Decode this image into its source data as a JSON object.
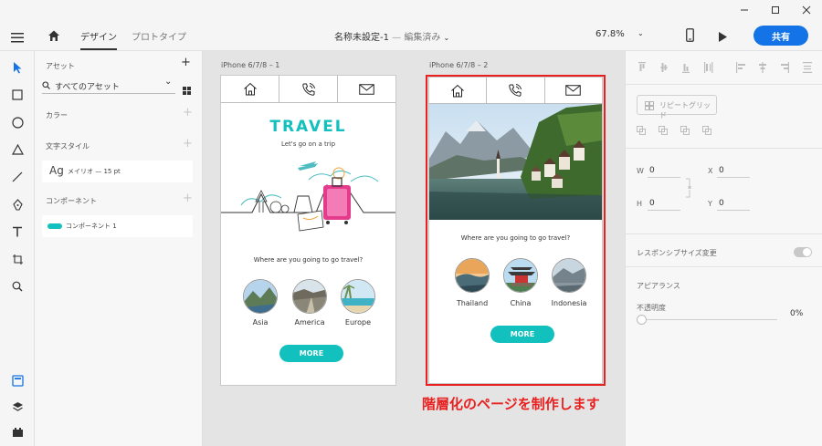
{
  "toolbar": {
    "tab_design": "デザイン",
    "tab_prototype": "プロトタイプ",
    "document_title": "名称未設定-1",
    "separator": "—",
    "save_status": "編集済み",
    "zoom": "67.8%",
    "share_label": "共有"
  },
  "assets": {
    "header": "アセット",
    "filter_value": "すべてのアセット",
    "colors_label": "カラー",
    "char_styles_label": "文字スタイル",
    "char_style_sample": "Ag",
    "char_style_name": "メイリオ — 15 pt",
    "components_label": "コンポーネント",
    "component_name": "コンポーネント 1"
  },
  "artboard1": {
    "title": "iPhone 6/7/8 – 1",
    "heading": "TRAVEL",
    "tagline": "Let's go on a trip",
    "question": "Where are you going to go travel?",
    "destinations": [
      "Asia",
      "America",
      "Europe"
    ],
    "more": "MORE"
  },
  "artboard2": {
    "title": "iPhone 6/7/8 – 2",
    "question": "Where are you going to go travel?",
    "destinations": [
      "Thailand",
      "China",
      "Indonesia"
    ],
    "more": "MORE"
  },
  "annotation": {
    "text": "階層化のページを制作します",
    "color": "#e8201f"
  },
  "properties": {
    "repeat_grid": "リピートグリッド",
    "w_label": "W",
    "w_value": "0",
    "x_label": "X",
    "x_value": "0",
    "h_label": "H",
    "h_value": "0",
    "y_label": "Y",
    "y_value": "0",
    "responsive_label": "レスポンシブサイズ変更",
    "appearance_label": "アピアランス",
    "opacity_label": "不透明度",
    "opacity_value": "0%"
  },
  "colors": {
    "accent_blue": "#1473e6",
    "teal": "#12c0bd",
    "highlight_red": "#e8201f"
  }
}
